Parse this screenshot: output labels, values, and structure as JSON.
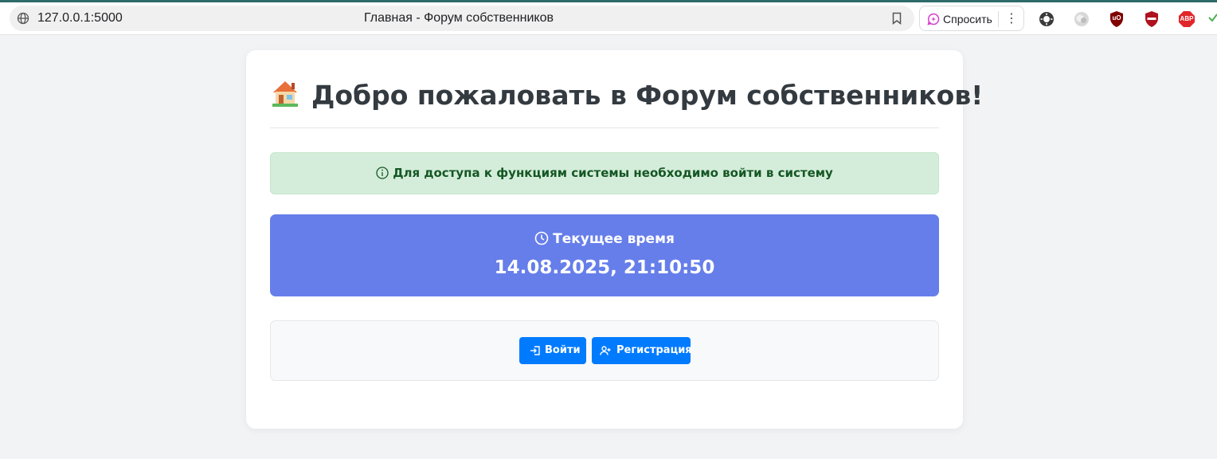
{
  "browser": {
    "url": "127.0.0.1:5000",
    "tab_title": "Главная - Форум собственников",
    "ask_label": "Спросить",
    "menu_glyph": "⋮",
    "extensions": [
      {
        "name": "dark-reader-icon",
        "label": ""
      },
      {
        "name": "ai-assistant-icon",
        "label": ""
      },
      {
        "name": "ublock-origin-icon",
        "label": "uO"
      },
      {
        "name": "privacy-badger-icon",
        "label": ""
      },
      {
        "name": "adblock-plus-icon",
        "label": "ABP"
      }
    ]
  },
  "page": {
    "heading": "Добро пожаловать в Форум собственников!",
    "alert_text": "Для доступа к функциям системы необходимо войти в систему",
    "clock_label": "Текущее время",
    "clock_value": "14.08.2025, 21:10:50",
    "login_label": "Войти",
    "register_label": "Регистрация"
  },
  "colors": {
    "accent_blue": "#007bff",
    "clock_bg": "#667eea",
    "alert_bg": "#d4edda",
    "alert_text": "#155724"
  }
}
